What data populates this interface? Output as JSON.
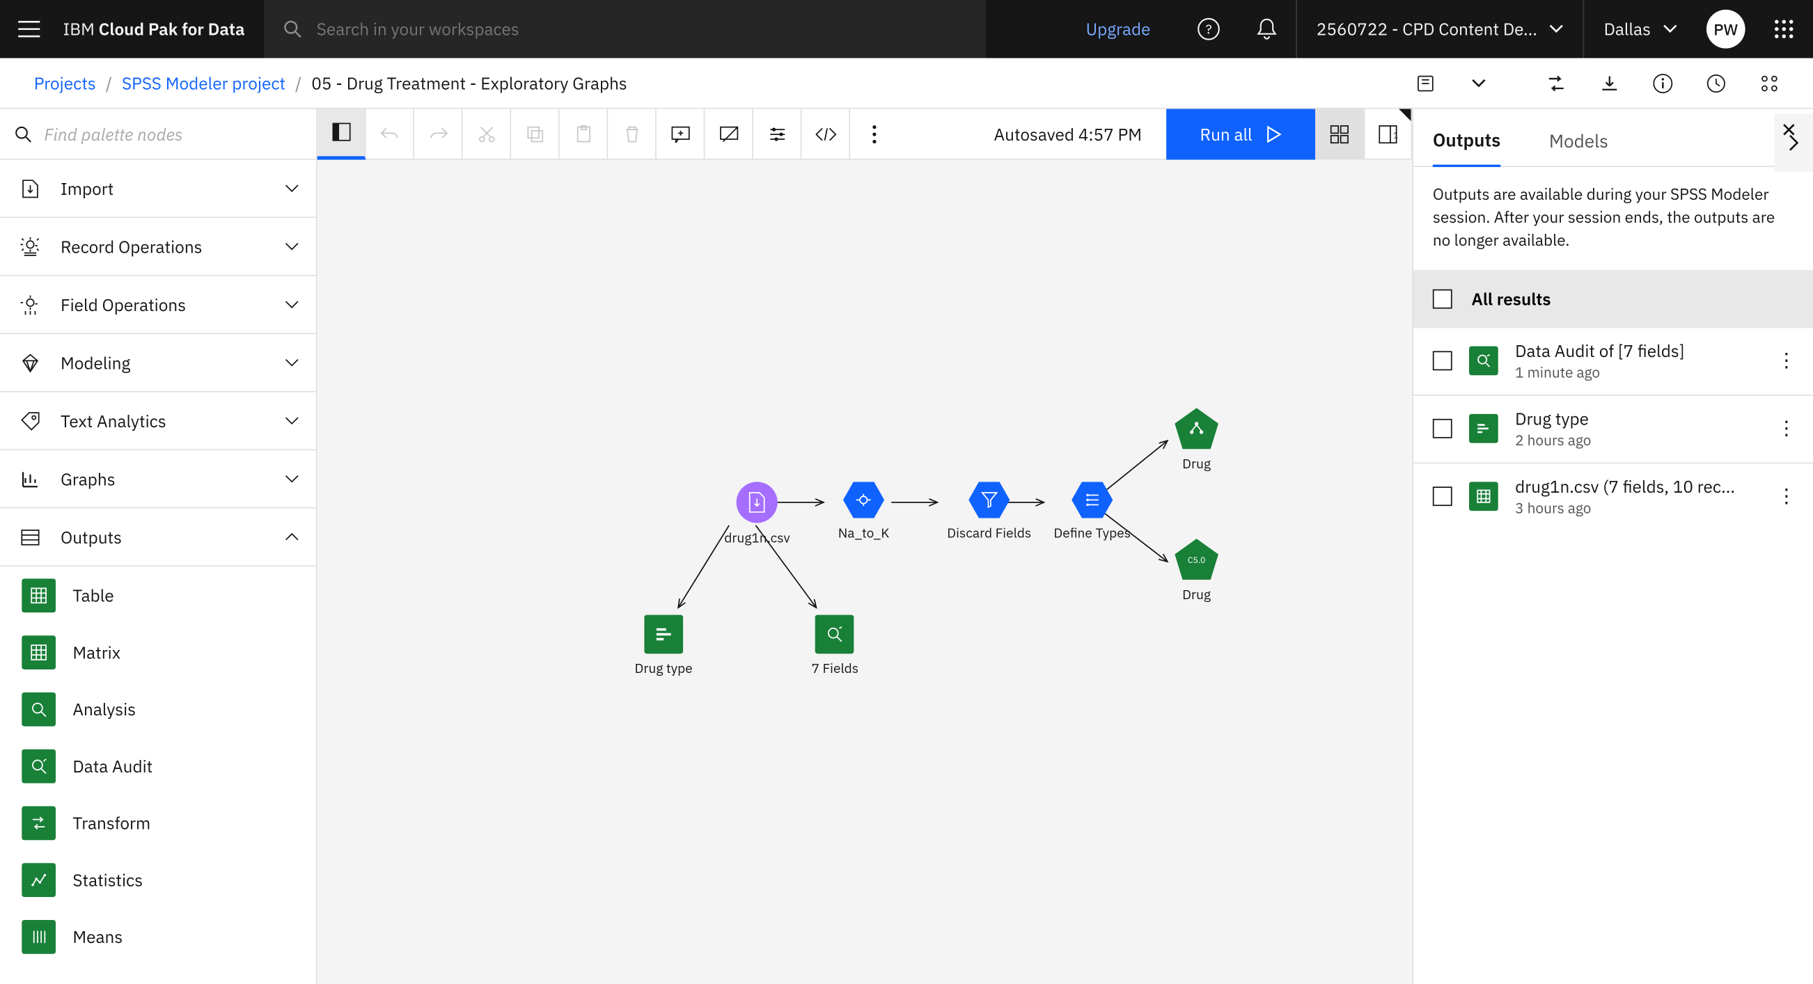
{
  "topbar": {
    "brand_ibm": "IBM",
    "brand_product": "Cloud Pak for Data",
    "search_placeholder": "Search in your workspaces",
    "upgrade": "Upgrade",
    "account": "2560722 - CPD Content De...",
    "region": "Dallas",
    "avatar": "PW"
  },
  "breadcrumb": {
    "root": "Projects",
    "project": "SPSS Modeler project",
    "current": "05 - Drug Treatment - Exploratory Graphs"
  },
  "toolbar": {
    "autosaved": "Autosaved 4:57 PM",
    "run_all": "Run all"
  },
  "palette": {
    "search_placeholder": "Find palette nodes",
    "groups": [
      {
        "label": "Import",
        "expanded": false
      },
      {
        "label": "Record Operations",
        "expanded": false
      },
      {
        "label": "Field Operations",
        "expanded": false
      },
      {
        "label": "Modeling",
        "expanded": false
      },
      {
        "label": "Text Analytics",
        "expanded": false
      },
      {
        "label": "Graphs",
        "expanded": false
      },
      {
        "label": "Outputs",
        "expanded": true
      }
    ],
    "outputs_children": [
      {
        "label": "Table"
      },
      {
        "label": "Matrix"
      },
      {
        "label": "Analysis"
      },
      {
        "label": "Data Audit"
      },
      {
        "label": "Transform"
      },
      {
        "label": "Statistics"
      },
      {
        "label": "Means"
      }
    ]
  },
  "canvas": {
    "nodes": {
      "source": "drug1n.csv",
      "na_to_k": "Na_to_K",
      "discard": "Discard Fields",
      "define": "Define Types",
      "drug_top": "Drug",
      "drug_bot": "Drug",
      "drugtype": "Drug type",
      "sevenfields": "7 Fields"
    }
  },
  "rpanel": {
    "tab_outputs": "Outputs",
    "tab_models": "Models",
    "note": "Outputs are available during your SPSS Modeler session. After your session ends, the outputs are no longer available.",
    "all_results": "All results",
    "results": [
      {
        "title": "Data Audit of [7 fields]",
        "time": "1 minute ago"
      },
      {
        "title": "Drug type",
        "time": "2 hours ago"
      },
      {
        "title": "drug1n.csv (7 fields, 10 rec...",
        "time": "3 hours ago"
      }
    ]
  }
}
